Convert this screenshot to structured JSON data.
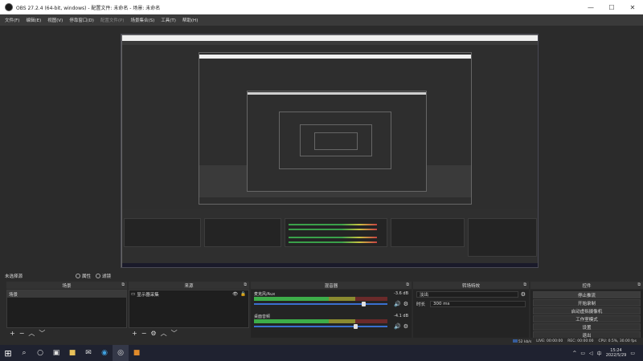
{
  "window": {
    "title": "OBS 27.2.4 (64-bit, windows) - 配置文件: 未命名 - 场景: 未命名",
    "minimize": "—",
    "maximize": "☐",
    "close": "✕"
  },
  "menu": [
    {
      "label": "文件(F)",
      "disabled": false
    },
    {
      "label": "编辑(E)",
      "disabled": false
    },
    {
      "label": "视图(V)",
      "disabled": false
    },
    {
      "label": "停靠窗口(D)",
      "disabled": false
    },
    {
      "label": "配置文件(P)",
      "disabled": true
    },
    {
      "label": "场景集合(S)",
      "disabled": false
    },
    {
      "label": "工具(T)",
      "disabled": false
    },
    {
      "label": "帮助(H)",
      "disabled": false
    }
  ],
  "toolbar": {
    "no_source_selected": "未选择源",
    "properties_label": "属性",
    "filters_label": "滤镜"
  },
  "scenes": {
    "title": "场景",
    "items": [
      "场景"
    ]
  },
  "sources": {
    "title": "来源",
    "items": [
      "显示器采集"
    ]
  },
  "mixer": {
    "title": "混音器",
    "channels": [
      {
        "name": "麦克风/Aux",
        "db": "-3.6 dB",
        "level": 0.82
      },
      {
        "name": "桌面音频",
        "db": "-4.1 dB",
        "level": 0.76
      }
    ]
  },
  "transitions": {
    "title": "转场特效",
    "selected": "淡出",
    "duration_label": "时长",
    "duration_value": "300 ms"
  },
  "controls": {
    "title": "控件",
    "buttons": [
      {
        "label": "停止推流",
        "active": true
      },
      {
        "label": "开始录制",
        "active": false
      },
      {
        "label": "启动虚拟摄像机",
        "active": false
      },
      {
        "label": "工作室模式",
        "active": false
      },
      {
        "label": "设置",
        "active": false
      },
      {
        "label": "退出",
        "active": false
      }
    ]
  },
  "status": {
    "live_frames": "52 kb/s",
    "live_time": "LIVE: 00:00:00",
    "rec_time": "REC: 00:00:00",
    "cpu": "CPU: 0.5%, 30.00 fps"
  },
  "taskbar": {
    "time": "15:24",
    "date": "2022/5/29",
    "lang": "中"
  },
  "accent_colors": {
    "meter_green": "#3dad49",
    "volume_blue": "#3a6fd0",
    "live_blue": "#375d9c"
  }
}
